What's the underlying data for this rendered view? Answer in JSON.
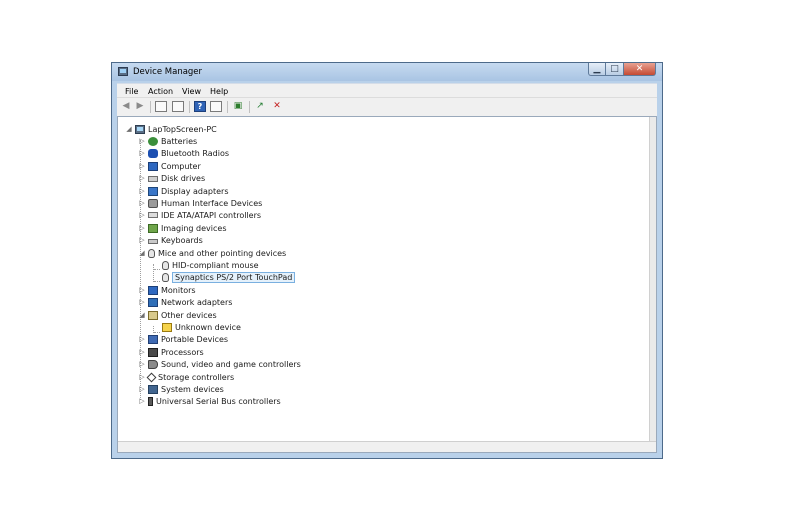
{
  "window": {
    "title": "Device Manager",
    "caption_buttons": {
      "minimize": "▁",
      "maximize": "□",
      "close": "✕"
    }
  },
  "menu": [
    "File",
    "Action",
    "View",
    "Help"
  ],
  "tree": {
    "root": "LapTopScreen-PC",
    "categories": [
      {
        "label": "Batteries",
        "icon": "battery-icon",
        "expanded": false
      },
      {
        "label": "Bluetooth Radios",
        "icon": "bluetooth-icon",
        "expanded": false
      },
      {
        "label": "Computer",
        "icon": "computer-icon",
        "expanded": false
      },
      {
        "label": "Disk drives",
        "icon": "disk-drive-icon",
        "expanded": false
      },
      {
        "label": "Display adapters",
        "icon": "display-adapter-icon",
        "expanded": false
      },
      {
        "label": "Human Interface Devices",
        "icon": "hid-icon",
        "expanded": false
      },
      {
        "label": "IDE ATA/ATAPI controllers",
        "icon": "ide-controller-icon",
        "expanded": false
      },
      {
        "label": "Imaging devices",
        "icon": "imaging-device-icon",
        "expanded": false
      },
      {
        "label": "Keyboards",
        "icon": "keyboard-icon",
        "expanded": false
      },
      {
        "label": "Mice and other pointing devices",
        "icon": "mouse-icon",
        "expanded": true,
        "children": [
          "HID-compliant mouse",
          "Synaptics PS/2 Port TouchPad"
        ]
      },
      {
        "label": "Monitors",
        "icon": "monitor-icon",
        "expanded": false
      },
      {
        "label": "Network adapters",
        "icon": "network-adapter-icon",
        "expanded": false
      },
      {
        "label": "Other devices",
        "icon": "other-device-icon",
        "expanded": true,
        "children": [
          "Unknown device"
        ]
      },
      {
        "label": "Portable Devices",
        "icon": "portable-device-icon",
        "expanded": false
      },
      {
        "label": "Processors",
        "icon": "processor-icon",
        "expanded": false
      },
      {
        "label": "Sound, video and game controllers",
        "icon": "sound-icon",
        "expanded": false
      },
      {
        "label": "Storage controllers",
        "icon": "storage-controller-icon",
        "expanded": false
      },
      {
        "label": "System devices",
        "icon": "system-device-icon",
        "expanded": false
      },
      {
        "label": "Universal Serial Bus controllers",
        "icon": "usb-icon",
        "expanded": false
      }
    ],
    "selected": "Synaptics PS/2 Port TouchPad"
  }
}
